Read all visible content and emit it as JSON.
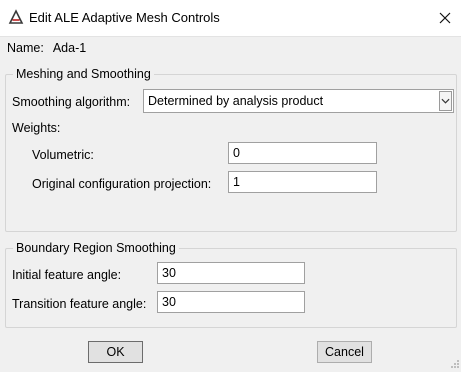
{
  "dialog": {
    "title": "Edit ALE Adaptive Mesh Controls",
    "icons": {
      "app": "abaqus-app-icon",
      "close": "close-icon"
    }
  },
  "name_row": {
    "label": "Name:",
    "value": "Ada-1"
  },
  "meshing": {
    "legend": "Meshing and Smoothing",
    "algorithm_label": "Smoothing algorithm:",
    "algorithm_value": "Determined by analysis product",
    "weights_label": "Weights:",
    "volumetric_label": "Volumetric:",
    "volumetric_value": "0",
    "projection_label": "Original configuration projection:",
    "projection_value": "1"
  },
  "boundary": {
    "legend": "Boundary Region Smoothing",
    "initial_label": "Initial feature angle:",
    "initial_value": "30",
    "transition_label": "Transition feature angle:",
    "transition_value": "30"
  },
  "buttons": {
    "ok": "OK",
    "cancel": "Cancel"
  },
  "colors": {
    "background": "#f0f0f0",
    "titlebar": "#ffffff",
    "field_border": "#a0a0a0",
    "button_face": "#e1e1e1"
  }
}
